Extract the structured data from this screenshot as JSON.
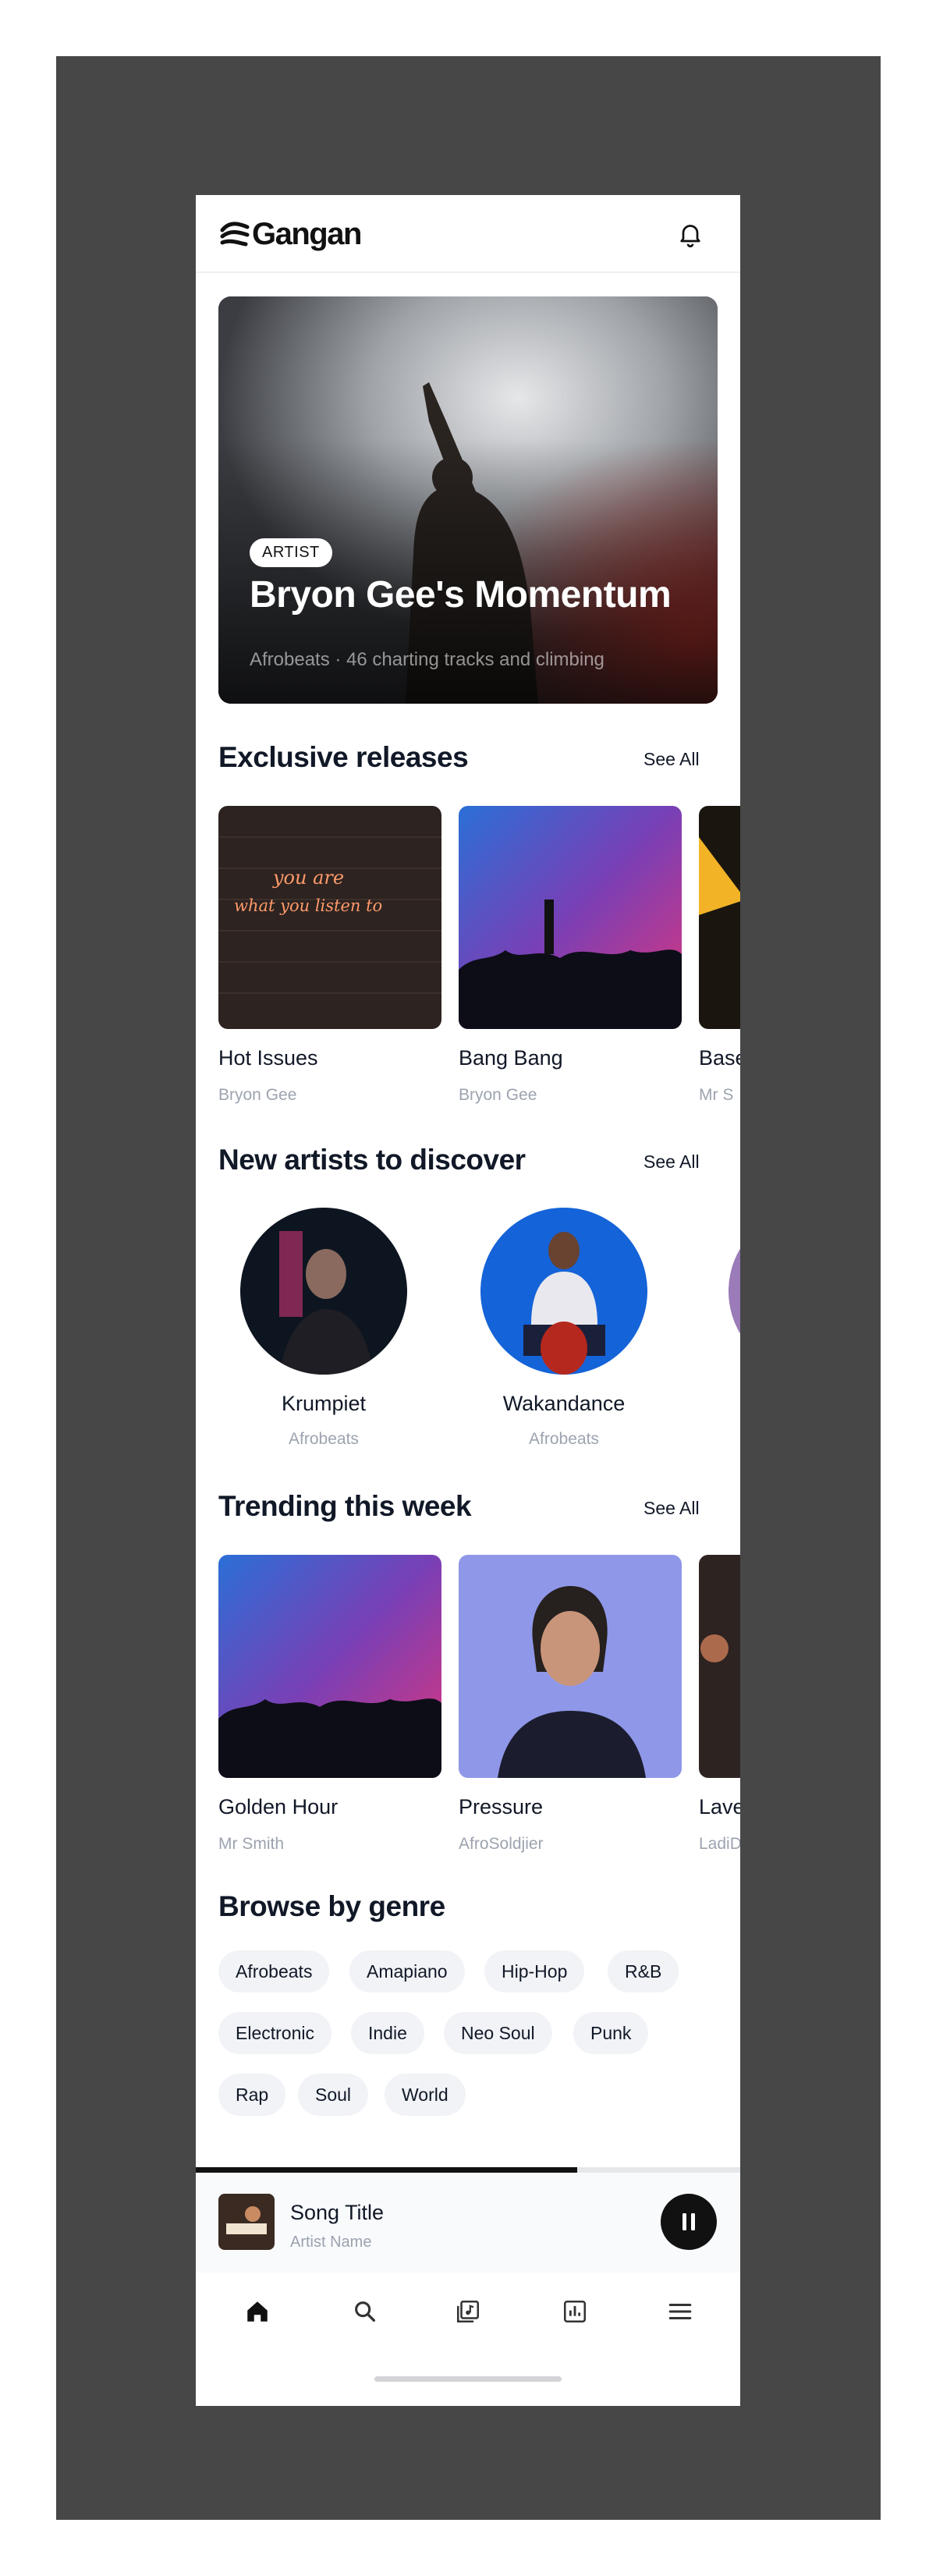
{
  "app": {
    "name": "Gangan"
  },
  "header": {
    "logo_icon": "gangan-wave-icon",
    "notification_icon": "bell-icon"
  },
  "hero": {
    "badge": "ARTIST",
    "title": "Bryon Gee's Momentum",
    "subtitle": "Afrobeats · 46 charting tracks and climbing"
  },
  "exclusive": {
    "title": "Exclusive releases",
    "see_all": "See All",
    "items": [
      {
        "title": "Hot Issues",
        "artist": "Bryon Gee",
        "art_text": "you are what you listen to"
      },
      {
        "title": "Bang Bang",
        "artist": "Bryon Gee"
      },
      {
        "title": "Base",
        "artist": "Mr S"
      }
    ]
  },
  "artists": {
    "title": "New artists to discover",
    "see_all": "See All",
    "items": [
      {
        "name": "Krumpiet",
        "genre": "Afrobeats"
      },
      {
        "name": "Wakandance",
        "genre": "Afrobeats"
      }
    ]
  },
  "trending": {
    "title": "Trending this week",
    "see_all": "See All",
    "items": [
      {
        "title": "Golden Hour",
        "artist": "Mr Smith"
      },
      {
        "title": "Pressure",
        "artist": "AfroSoldjier"
      },
      {
        "title": "Lave",
        "artist": "LadiD"
      }
    ]
  },
  "genres": {
    "title": "Browse by genre",
    "chips": [
      "Afrobeats",
      "Amapiano",
      "Hip-Hop",
      "R&B",
      "Electronic",
      "Indie",
      "Neo Soul",
      "Punk",
      "Rap",
      "Soul",
      "World"
    ]
  },
  "player": {
    "song": "Song Title",
    "artist": "Artist Name",
    "progress": 0.7,
    "button_icon": "pause-icon"
  },
  "nav": {
    "items": [
      "home-icon",
      "search-icon",
      "library-icon",
      "stats-icon",
      "menu-icon"
    ]
  },
  "colors": {
    "accent": "#111111",
    "muted": "#9ca3af",
    "chip_bg": "#f1f3f6",
    "frame": "#474747"
  }
}
